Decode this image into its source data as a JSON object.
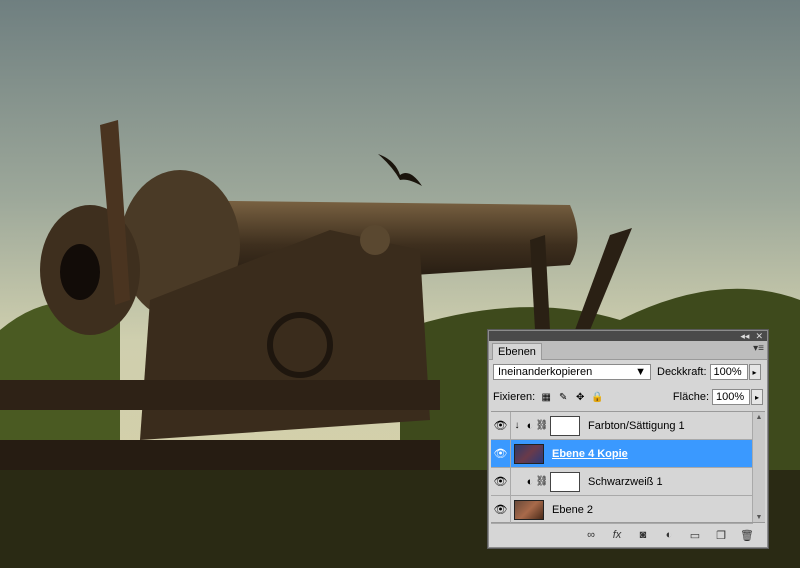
{
  "panel": {
    "tab_title": "Ebenen",
    "top_controls": [
      "◂◂",
      "✕"
    ],
    "menu_icon": "panel-menu-icon",
    "blend_mode": "Ineinanderkopieren",
    "opacity_label": "Deckkraft:",
    "opacity_value": "100%",
    "lock_label": "Fixieren:",
    "fill_label": "Fläche:",
    "fill_value": "100%"
  },
  "layers": [
    {
      "name": "Farbton/Sättigung 1",
      "type": "adjustment",
      "clipped": true,
      "selected": false
    },
    {
      "name": "Ebene 4 Kopie",
      "type": "image",
      "clipped": false,
      "selected": true
    },
    {
      "name": "Schwarzweiß 1",
      "type": "adjustment",
      "clipped": false,
      "selected": false
    },
    {
      "name": "Ebene 2",
      "type": "image",
      "clipped": false,
      "selected": false
    }
  ],
  "footer_icons": [
    "link-icon",
    "fx-icon",
    "mask-icon",
    "adjustment-icon",
    "folder-icon",
    "new-layer-icon",
    "trash-icon"
  ],
  "colors": {
    "selection": "#3a99ff",
    "panel_bg": "#d6d6d6"
  }
}
